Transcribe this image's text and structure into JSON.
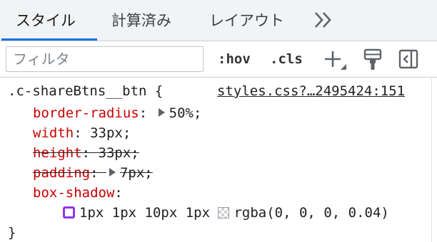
{
  "tabs": [
    {
      "label": "スタイル",
      "active": true
    },
    {
      "label": "計算済み",
      "active": false
    },
    {
      "label": "レイアウト",
      "active": false
    }
  ],
  "overflow_icon": "double-chevron-right-icon",
  "toolbar": {
    "filter_placeholder": "フィルタ",
    "hov_label": ":hov",
    "cls_label": ".cls",
    "icons": [
      "add-rule-plus-icon",
      "paint-brush-icon",
      "toggle-sidebar-icon"
    ]
  },
  "rule": {
    "selector": ".c-shareBtns__btn {",
    "source": "styles.css?…2495424:151",
    "close": "}",
    "declarations": [
      {
        "name": "border-radius",
        "colon": ":",
        "value": "50%;",
        "expandable": true,
        "overridden": false
      },
      {
        "name": "width",
        "colon": ":",
        "value": "33px;",
        "expandable": false,
        "overridden": false
      },
      {
        "name": "height",
        "colon": ":",
        "value": "33px;",
        "expandable": false,
        "overridden": true
      },
      {
        "name": "padding",
        "colon": ":",
        "value": "7px;",
        "expandable": true,
        "overridden": true
      },
      {
        "name": "box-shadow",
        "colon": ":",
        "value": "",
        "expandable": false,
        "overridden": false
      }
    ],
    "box_shadow_value": {
      "offsets": "1px 1px 10px 1px",
      "color": "rgba(0, 0, 0, 0.04)"
    }
  },
  "colors": {
    "accent": "#1a73e8",
    "property": "#c80000",
    "shadow_swatch": "#9334e6"
  }
}
